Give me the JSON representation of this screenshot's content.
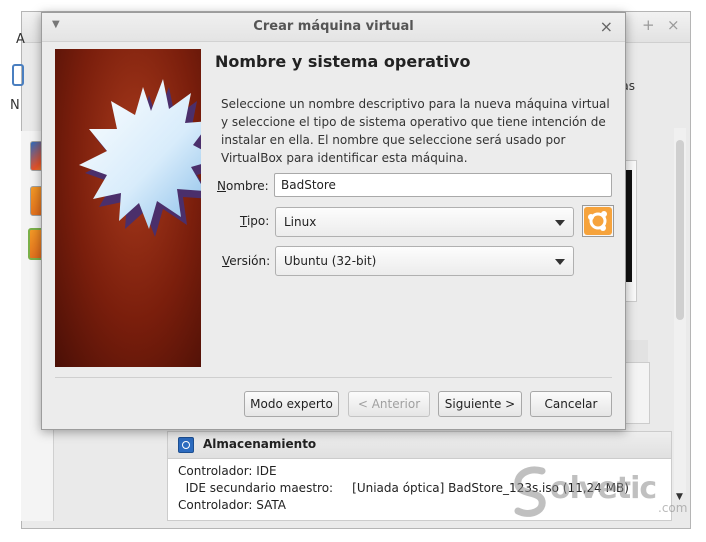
{
  "background_window": {
    "fragment_menu": "A",
    "fragment_left": "N",
    "fragment_right": "áneas",
    "storage": {
      "title": "Almacenamiento",
      "lines": [
        "Controlador: IDE",
        "  IDE secundario maestro:     [Uniada óptica] BadStore_123s.iso (11,24 MB)",
        "Controlador: SATA"
      ]
    },
    "window_controls": {
      "add": "+",
      "close": "×"
    }
  },
  "watermark": {
    "text": "olvetic",
    "suffix": ".com"
  },
  "dialog": {
    "title": "Crear máquina virtual",
    "heading": "Nombre y sistema operativo",
    "description": "Seleccione un nombre descriptivo para la nueva máquina virtual y seleccione el tipo de sistema operativo que tiene intención de instalar en ella. El nombre que seleccione será usado por VirtualBox para identificar esta máquina.",
    "form": {
      "name_label_key": "N",
      "name_label_rest": "ombre:",
      "name_value": "BadStore",
      "type_label_key": "T",
      "type_label_rest": "ipo:",
      "type_value": "Linux",
      "version_label_key": "V",
      "version_label_rest": "ersión:",
      "version_value": "Ubuntu (32-bit)"
    },
    "buttons": {
      "expert": "Modo experto",
      "back": "< Anterior",
      "next": "Siguiente >",
      "cancel": "Cancelar"
    },
    "os_icon": "ubuntu-logo-icon"
  }
}
